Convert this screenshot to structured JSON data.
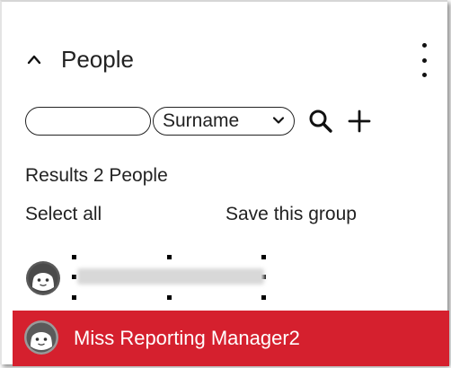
{
  "panel": {
    "title": "People",
    "search": {
      "value": "",
      "placeholder": ""
    },
    "field_select": {
      "selected": "Surname"
    },
    "results_text": "Results 2 People",
    "select_all_label": "Select all",
    "save_group_label": "Save this group",
    "people": [
      {
        "name": "",
        "selected": false,
        "name_redacted": true
      },
      {
        "name": "Miss Reporting Manager2",
        "selected": true
      }
    ]
  },
  "icons": {
    "collapse": "chevron-up-icon",
    "menu": "kebab-menu-icon",
    "search": "search-icon",
    "add": "plus-icon",
    "avatar": "avatar-icon"
  },
  "colors": {
    "selected_row": "#d5202e",
    "selected_text": "#ffffff",
    "text": "#222222"
  }
}
